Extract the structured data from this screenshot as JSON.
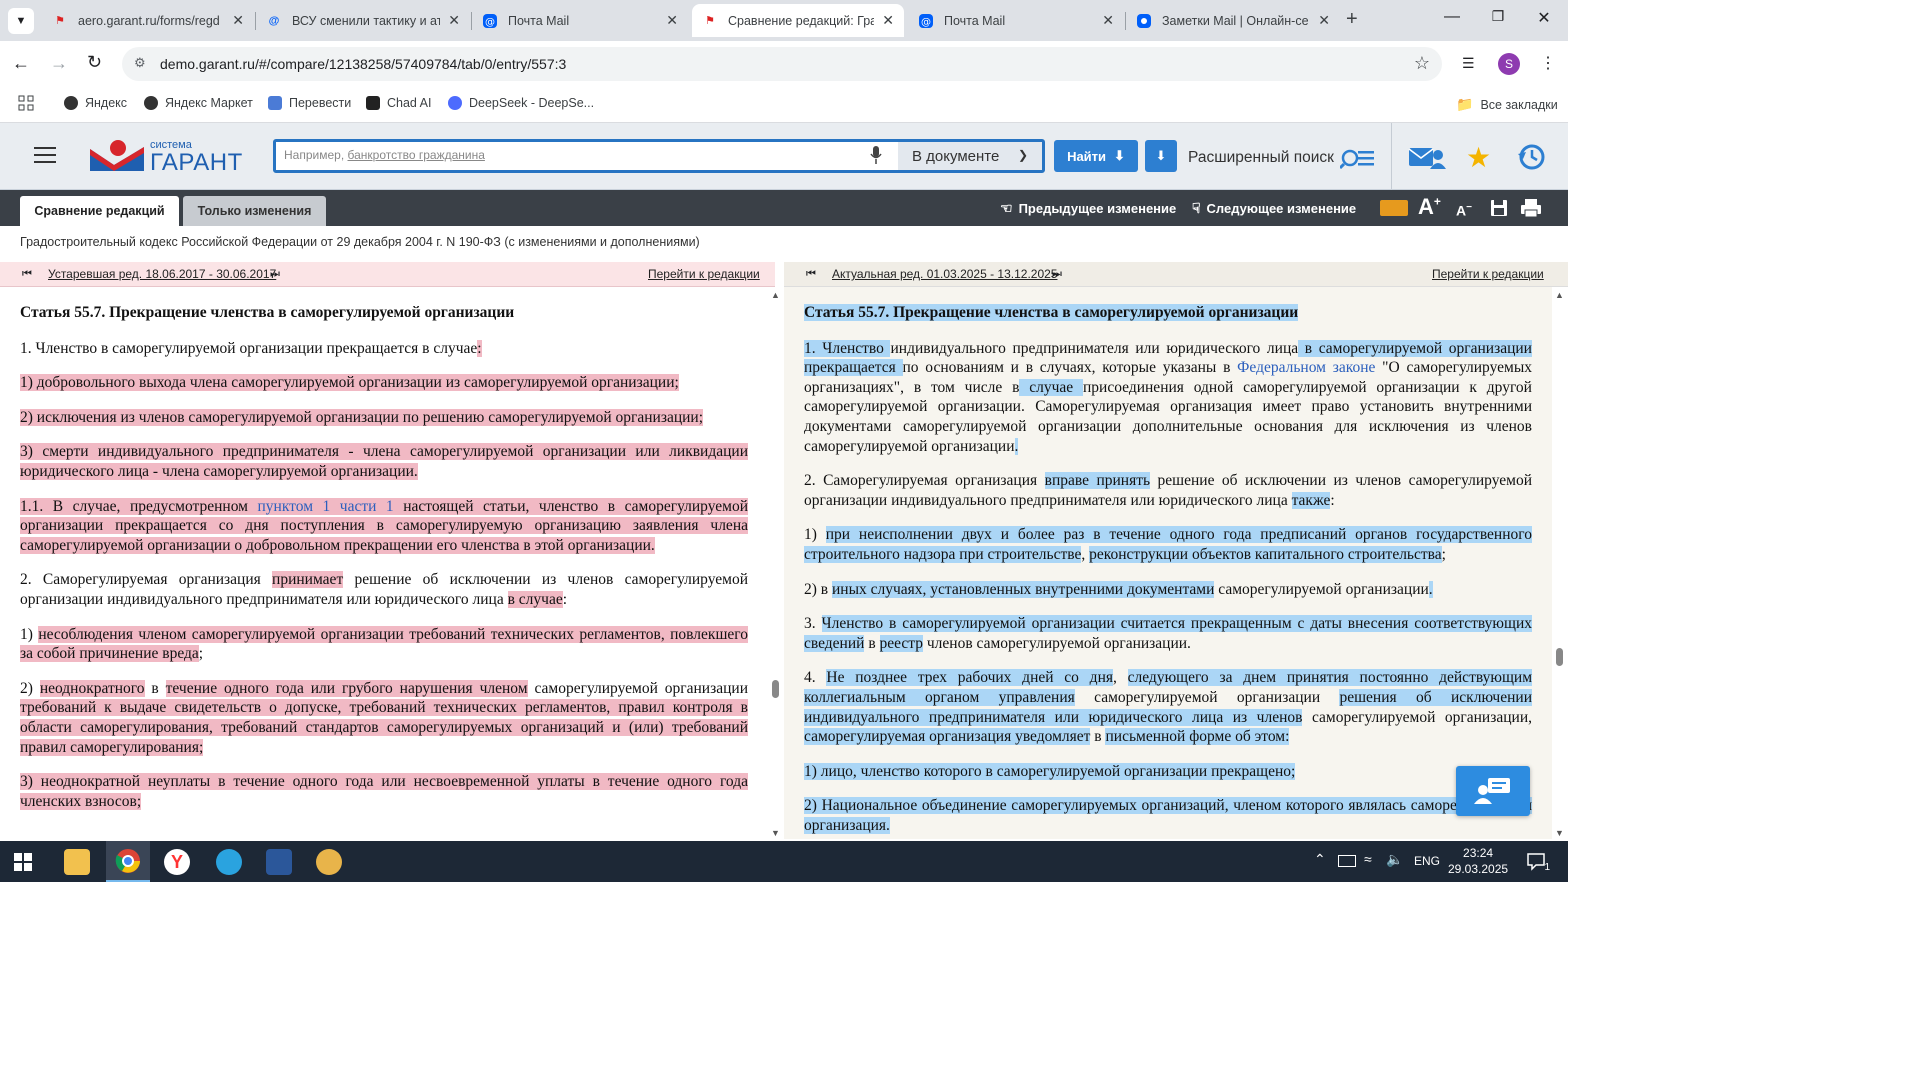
{
  "browser": {
    "tabs": [
      {
        "title": "aero.garant.ru/forms/regd",
        "active": false
      },
      {
        "title": "ВСУ сменили тактику и ат",
        "active": false
      },
      {
        "title": "Почта Mail",
        "active": false
      },
      {
        "title": "Сравнение редакций: Гра",
        "active": true
      },
      {
        "title": "Почта Mail",
        "active": false
      },
      {
        "title": "Заметки Mail | Онлайн-се",
        "active": false
      }
    ],
    "url": "demo.garant.ru/#/compare/12138258/57409784/tab/0/entry/557:3",
    "profile_initial": "S",
    "bookmarks": [
      "Яндекс",
      "Яндекс Маркет",
      "Перевести",
      "Chad AI",
      "DeepSeek - DeepSe..."
    ],
    "all_bookmarks": "Все закладки"
  },
  "garant": {
    "logo_small": "система",
    "logo_big": "ГАРАНТ",
    "search_placeholder_prefix": "Например,",
    "search_placeholder_link": "банкротство гражданина",
    "search_scope": "В документе",
    "find_label": "Найти",
    "advanced_search": "Расширенный поиск"
  },
  "toolbar": {
    "tab_compare": "Сравнение редакций",
    "tab_changes_only": "Только изменения",
    "prev_change": "Предыдущее изменение",
    "next_change": "Следующее изменение",
    "font_larger": "A",
    "font_smaller": "A"
  },
  "document_title": "Градостроительный кодекс Российской Федерации от 29 декабря 2004 г. N 190-ФЗ (с изменениями и дополнениями)",
  "left_pane": {
    "revision": "Устаревшая ред. 18.06.2017 - 30.06.2017",
    "goto": "Перейти к редакции"
  },
  "right_pane": {
    "revision": "Актуальная ред. 01.03.2025 - 13.12.2025",
    "goto": "Перейти к редакции"
  },
  "taskbar": {
    "lang": "ENG",
    "time": "23:24",
    "date": "29.03.2025",
    "notifications": "1"
  }
}
